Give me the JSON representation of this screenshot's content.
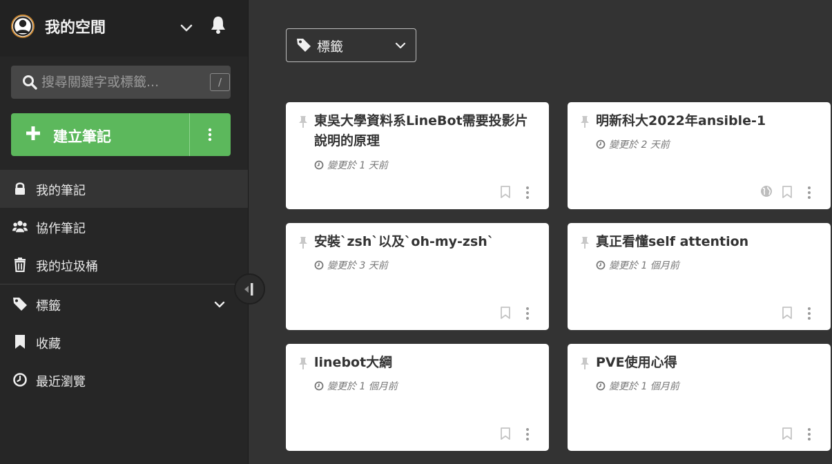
{
  "header": {
    "space_title": "我的空間"
  },
  "search": {
    "placeholder": "搜尋關鍵字或標籤...",
    "shortcut": "/"
  },
  "create": {
    "label": "建立筆記"
  },
  "nav": {
    "items": [
      {
        "label": "我的筆記",
        "icon": "lock-icon",
        "active": true
      },
      {
        "label": "協作筆記",
        "icon": "users-icon",
        "active": false
      },
      {
        "label": "我的垃圾桶",
        "icon": "trash-icon",
        "active": false
      },
      {
        "label": "標籤",
        "icon": "tag-icon",
        "active": false
      },
      {
        "label": "收藏",
        "icon": "bookmark-icon",
        "active": false
      },
      {
        "label": "最近瀏覽",
        "icon": "clock-icon",
        "active": false
      }
    ]
  },
  "filter": {
    "tag_label": "標籤"
  },
  "notes": [
    {
      "title": "東吳大學資料系LineBot需要投影片說明的原理",
      "updated": "變更於 1 天前",
      "public": false
    },
    {
      "title": "明新科大2022年ansible-1",
      "updated": "變更於 2 天前",
      "public": true
    },
    {
      "title": "安裝`zsh`以及`oh-my-zsh`",
      "updated": "變更於 3 天前",
      "public": false
    },
    {
      "title": "真正看懂self attention",
      "updated": "變更於 1 個月前",
      "public": false
    },
    {
      "title": "linebot大綱",
      "updated": "變更於 1 個月前",
      "public": false
    },
    {
      "title": "PVE使用心得",
      "updated": "變更於 1 個月前",
      "public": false
    }
  ],
  "colors": {
    "accent_green": "#5cb85c",
    "sidebar_bg": "#262626",
    "main_bg": "#333333",
    "card_bg": "#ffffff"
  }
}
